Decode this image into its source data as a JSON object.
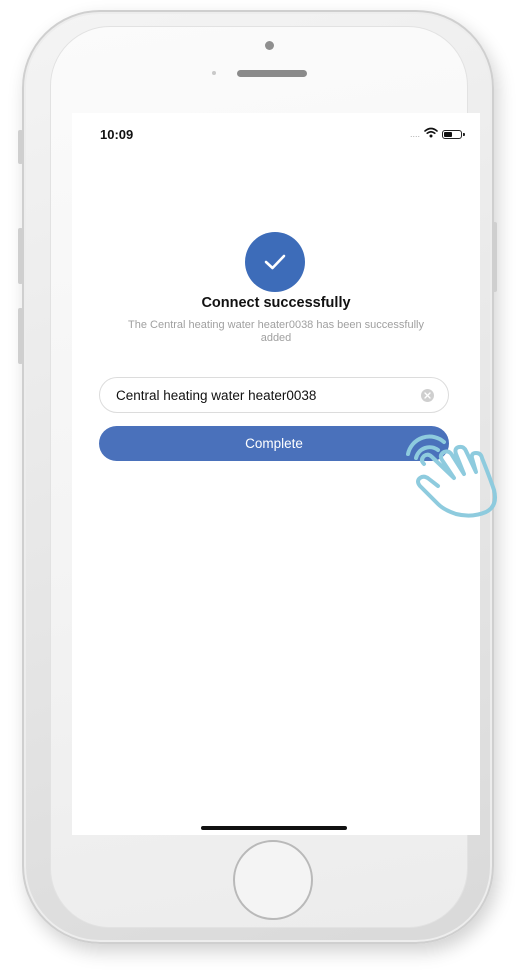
{
  "status_bar": {
    "time": "10:09",
    "signal": "....",
    "icons": [
      "wifi-icon",
      "battery-icon"
    ]
  },
  "success": {
    "icon": "checkmark-icon",
    "title": "Connect successfully",
    "message": "The Central heating water heater0038 has been successfully added"
  },
  "device_name_input": {
    "value": "Central heating water heater0038",
    "clear_icon": "clear-icon"
  },
  "complete_button": {
    "label": "Complete"
  },
  "overlay": {
    "icon": "tap-hand-icon"
  },
  "colors": {
    "accent": "#4a71bb",
    "check_circle": "#3d6cb9",
    "hand_outline": "#8ecbde",
    "text_muted": "#a0a0a0"
  }
}
